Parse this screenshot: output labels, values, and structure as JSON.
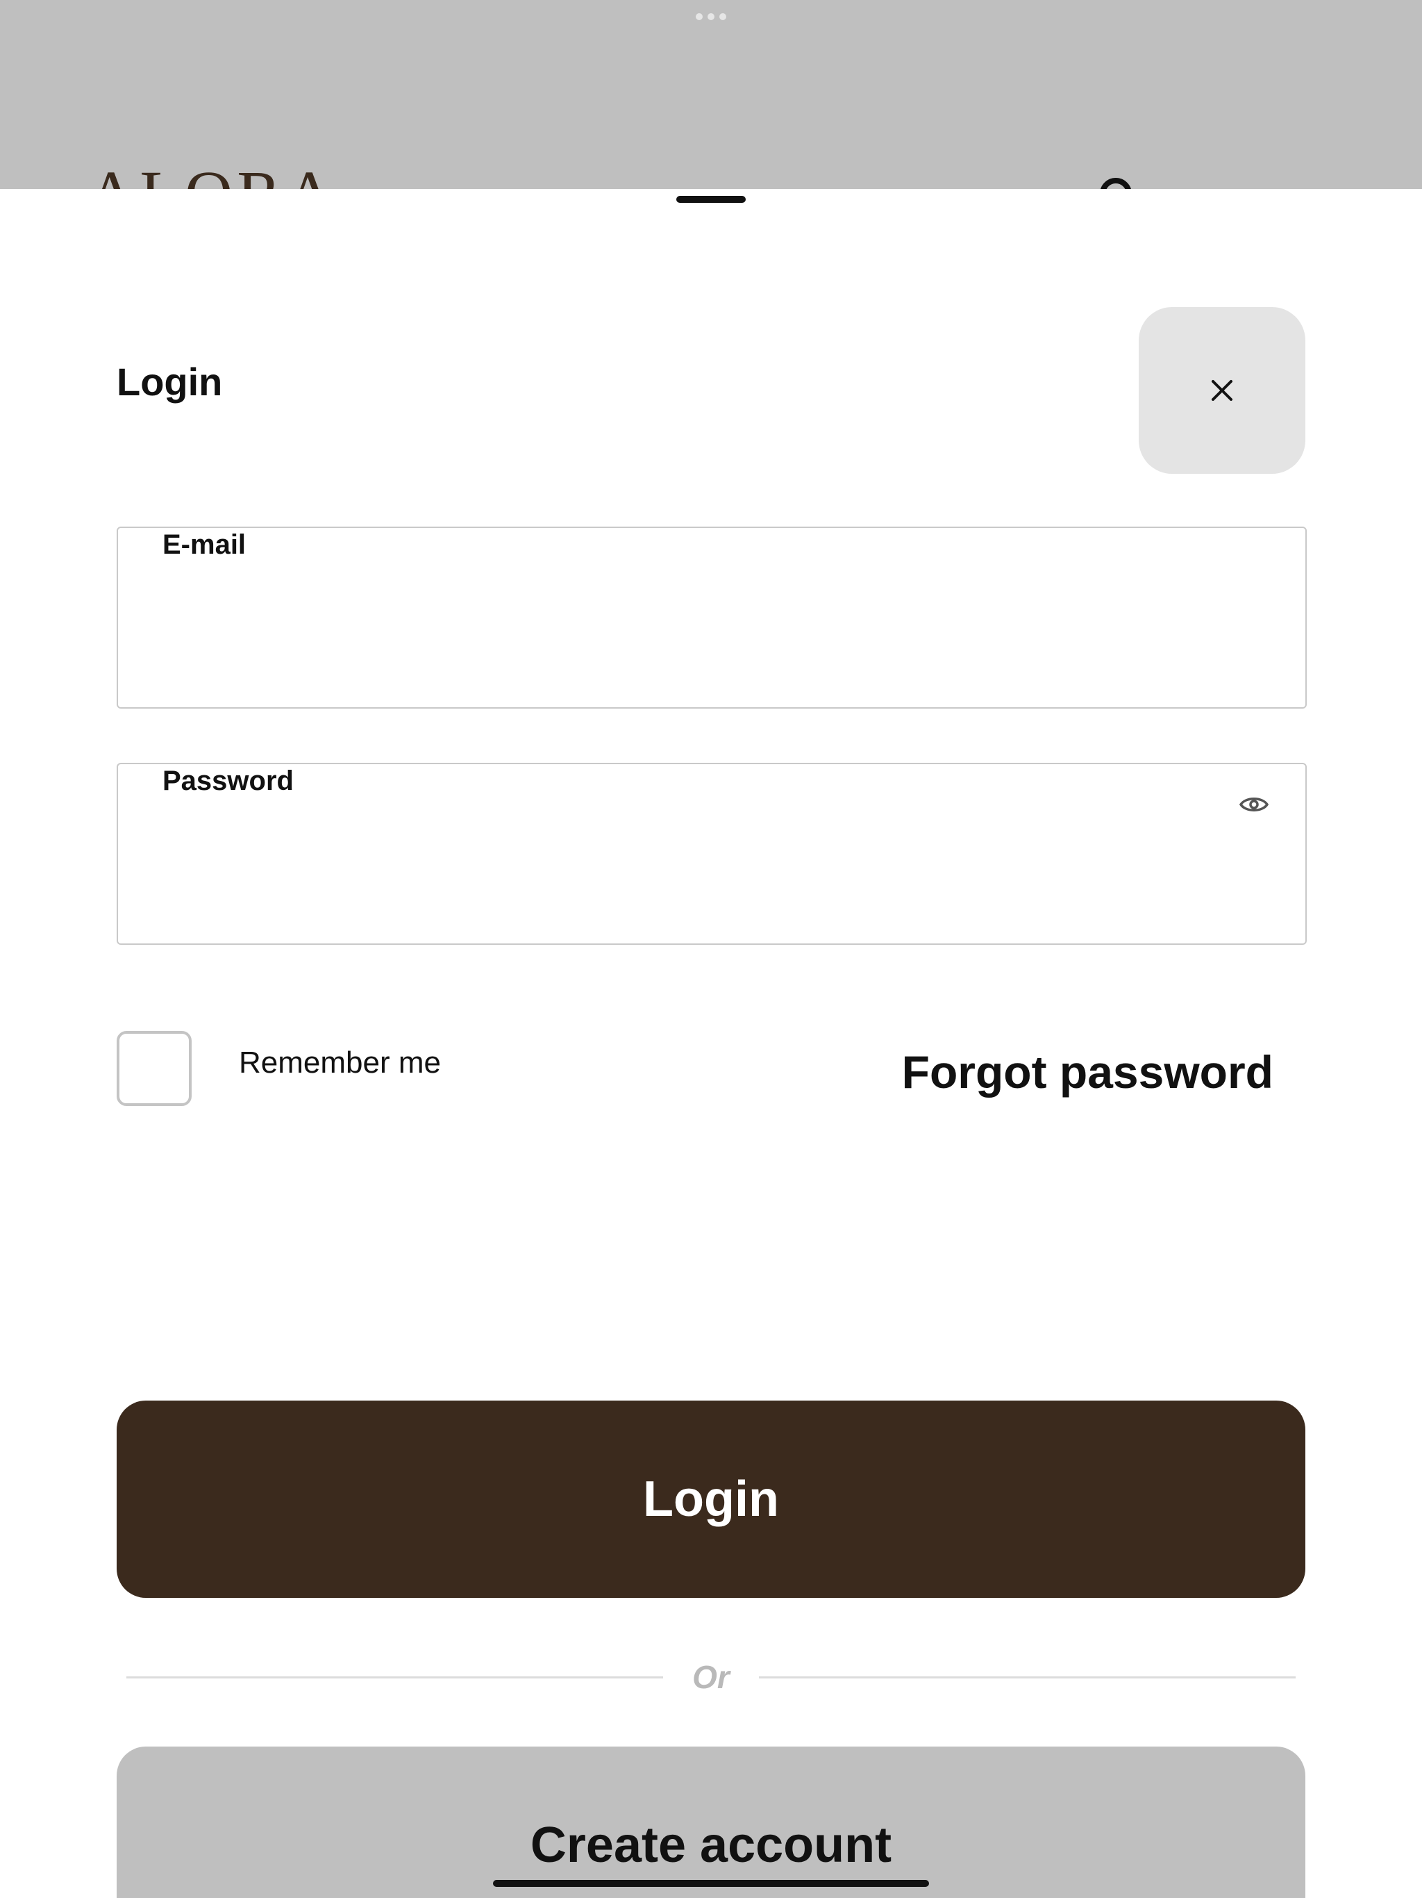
{
  "background": {
    "logo_text": "ALORA"
  },
  "sheet": {
    "title": "Login",
    "close_icon": "close-icon"
  },
  "email_field": {
    "label": "E-mail",
    "value": "",
    "placeholder": ""
  },
  "password_field": {
    "label": "Password",
    "value": "",
    "placeholder": "",
    "toggle_icon": "eye-icon"
  },
  "options": {
    "remember_label": "Remember me",
    "remember_checked": false,
    "forgot_label": "Forgot password"
  },
  "actions": {
    "login_label": "Login",
    "divider_label": "Or",
    "create_account_label": "Create account"
  },
  "colors": {
    "primary": "#3b2a1d",
    "secondary": "#bfbfbf",
    "close_bg": "#e4e4e4"
  }
}
